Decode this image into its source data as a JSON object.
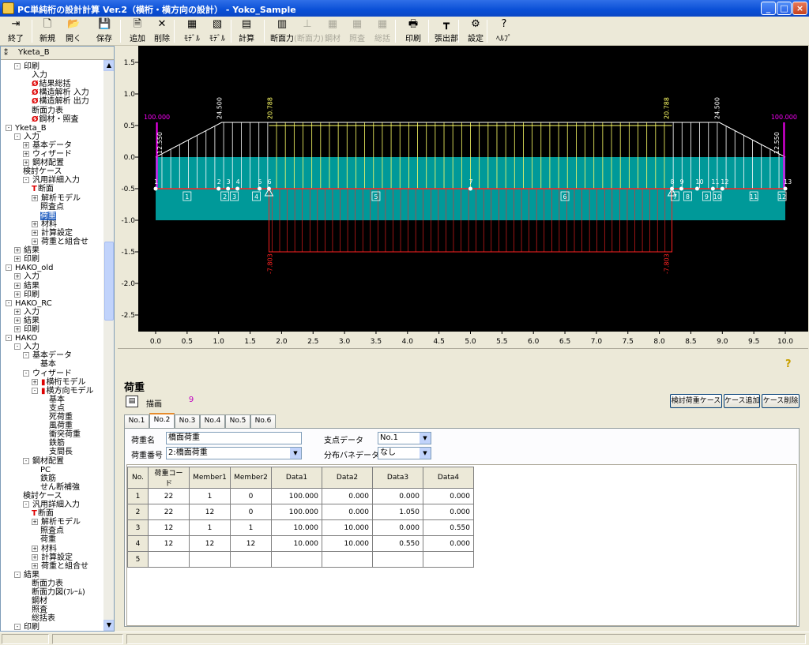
{
  "window": {
    "title": "PC単純桁の設計計算 Ver.2（横桁・横方向の設計） - Yoko_Sample",
    "minimize": "_",
    "maximize": "□",
    "close": "×"
  },
  "toolbar": {
    "items": [
      {
        "label": "終了",
        "icon": "exit-icon",
        "glyph": "⇥"
      },
      {
        "label": "新規",
        "icon": "new-file-icon",
        "glyph": "🗋"
      },
      {
        "label": "開く",
        "icon": "open-folder-icon",
        "glyph": "📂"
      },
      {
        "label": "保存",
        "icon": "save-disk-icon",
        "glyph": "💾"
      },
      {
        "label": "追加",
        "icon": "add-icon",
        "glyph": "🗎"
      },
      {
        "label": "削除",
        "icon": "delete-icon",
        "glyph": "✕"
      },
      {
        "label": "ﾓﾃﾞﾙ",
        "icon": "model-icon",
        "glyph": "▦"
      },
      {
        "label": "ﾓﾃﾞﾙ",
        "icon": "model2-icon",
        "glyph": "▧"
      },
      {
        "label": "計算",
        "icon": "calculate-icon",
        "glyph": "▤"
      },
      {
        "label": "断面力",
        "icon": "section-force-icon",
        "glyph": "▥"
      },
      {
        "label": "(断面力)",
        "icon": "section-force2-icon",
        "glyph": "⊥"
      },
      {
        "label": "鋼材",
        "icon": "steel-icon",
        "glyph": "▦"
      },
      {
        "label": "照査",
        "icon": "check-icon",
        "glyph": "▦"
      },
      {
        "label": "総括",
        "icon": "summary-icon",
        "glyph": "▦"
      },
      {
        "label": "印刷",
        "icon": "print-icon",
        "glyph": "🖶"
      },
      {
        "label": "張出部",
        "icon": "overhang-icon",
        "glyph": "┳"
      },
      {
        "label": "設定",
        "icon": "settings-icon",
        "glyph": "⚙"
      },
      {
        "label": "ﾍﾙﾌﾟ",
        "icon": "help-icon",
        "glyph": "?"
      }
    ]
  },
  "tree": {
    "header": "Yketa_B",
    "nodes": [
      {
        "text": "印刷",
        "indent": 1,
        "toggle": "-"
      },
      {
        "text": "入力",
        "indent": 3
      },
      {
        "text": "結果総括",
        "indent": 3,
        "mark": "Ø"
      },
      {
        "text": "構造解析 入力",
        "indent": 3,
        "mark": "Ø"
      },
      {
        "text": "構造解析 出力",
        "indent": 3,
        "mark": "Ø"
      },
      {
        "text": "断面力表",
        "indent": 3
      },
      {
        "text": "鋼材・照査",
        "indent": 3,
        "mark": "Ø"
      },
      {
        "text": "Yketa_B",
        "indent": 0,
        "toggle": "-"
      },
      {
        "text": "入力",
        "indent": 1,
        "toggle": "-"
      },
      {
        "text": "基本データ",
        "indent": 2,
        "toggle": "+"
      },
      {
        "text": "ウィザード",
        "indent": 2,
        "toggle": "+"
      },
      {
        "text": "鋼材配置",
        "indent": 2,
        "toggle": "+"
      },
      {
        "text": "検討ケース",
        "indent": 2
      },
      {
        "text": "汎用詳細入力",
        "indent": 2,
        "toggle": "-"
      },
      {
        "text": "断面",
        "indent": 3,
        "mark": "T"
      },
      {
        "text": "解析モデル",
        "indent": 3,
        "toggle": "+"
      },
      {
        "text": "照査点",
        "indent": 4
      },
      {
        "text": "荷重",
        "indent": 4,
        "selected": true
      },
      {
        "text": "材料",
        "indent": 3,
        "toggle": "+"
      },
      {
        "text": "計算設定",
        "indent": 3,
        "toggle": "+"
      },
      {
        "text": "荷重と組合せ",
        "indent": 3,
        "toggle": "+"
      },
      {
        "text": "結果",
        "indent": 1,
        "toggle": "+"
      },
      {
        "text": "印刷",
        "indent": 1,
        "toggle": "+"
      },
      {
        "text": "HAKO_old",
        "indent": 0,
        "toggle": "-"
      },
      {
        "text": "入力",
        "indent": 1,
        "toggle": "+"
      },
      {
        "text": "結果",
        "indent": 1,
        "toggle": "+"
      },
      {
        "text": "印刷",
        "indent": 1,
        "toggle": "+"
      },
      {
        "text": "HAKO_RC",
        "indent": 0,
        "toggle": "-"
      },
      {
        "text": "入力",
        "indent": 1,
        "toggle": "+"
      },
      {
        "text": "結果",
        "indent": 1,
        "toggle": "+"
      },
      {
        "text": "印刷",
        "indent": 1,
        "toggle": "+"
      },
      {
        "text": "HAKO",
        "indent": 0,
        "toggle": "-"
      },
      {
        "text": "入力",
        "indent": 1,
        "toggle": "-"
      },
      {
        "text": "基本データ",
        "indent": 2,
        "toggle": "-"
      },
      {
        "text": "基本",
        "indent": 4
      },
      {
        "text": "ウィザード",
        "indent": 2,
        "toggle": "-"
      },
      {
        "text": "横桁モデル",
        "indent": 3,
        "toggle": "+",
        "mark": "▮"
      },
      {
        "text": "横方向モデル",
        "indent": 3,
        "toggle": "-",
        "mark": "▮"
      },
      {
        "text": "基本",
        "indent": 5
      },
      {
        "text": "支点",
        "indent": 5
      },
      {
        "text": "死荷重",
        "indent": 5
      },
      {
        "text": "風荷重",
        "indent": 5
      },
      {
        "text": "衝突荷重",
        "indent": 5
      },
      {
        "text": "鉄筋",
        "indent": 5
      },
      {
        "text": "支間長",
        "indent": 5
      },
      {
        "text": "鋼材配置",
        "indent": 2,
        "toggle": "-"
      },
      {
        "text": "PC",
        "indent": 4
      },
      {
        "text": "鉄筋",
        "indent": 4
      },
      {
        "text": "せん断補強",
        "indent": 4
      },
      {
        "text": "検討ケース",
        "indent": 2
      },
      {
        "text": "汎用詳細入力",
        "indent": 2,
        "toggle": "-"
      },
      {
        "text": "断面",
        "indent": 3,
        "mark": "T"
      },
      {
        "text": "解析モデル",
        "indent": 3,
        "toggle": "+"
      },
      {
        "text": "照査点",
        "indent": 4
      },
      {
        "text": "荷重",
        "indent": 4
      },
      {
        "text": "材料",
        "indent": 3,
        "toggle": "+"
      },
      {
        "text": "計算設定",
        "indent": 3,
        "toggle": "+"
      },
      {
        "text": "荷重と組合せ",
        "indent": 3,
        "toggle": "+"
      },
      {
        "text": "結果",
        "indent": 1,
        "toggle": "-"
      },
      {
        "text": "断面力表",
        "indent": 3
      },
      {
        "text": "断面力図(ﾌﾚｰﾑ)",
        "indent": 3
      },
      {
        "text": "鋼材",
        "indent": 3
      },
      {
        "text": "照査",
        "indent": 3
      },
      {
        "text": "総括表",
        "indent": 3
      },
      {
        "text": "印刷",
        "indent": 1,
        "toggle": "-"
      }
    ]
  },
  "graph": {
    "y_ticks": [
      "1.5",
      "1.0",
      "0.5",
      "0.0",
      "-0.5",
      "-1.0",
      "-1.5",
      "-2.0",
      "-2.5"
    ],
    "x_ticks": [
      "0.0",
      "0.5",
      "1.0",
      "1.5",
      "2.0",
      "2.5",
      "3.0",
      "3.5",
      "4.0",
      "4.5",
      "5.0",
      "5.5",
      "6.0",
      "6.5",
      "7.0",
      "7.5",
      "8.0",
      "8.5",
      "9.0",
      "9.5",
      "10.0"
    ],
    "labels": {
      "mag_left": "100.000",
      "mag_right": "100.000",
      "mag_side_left": "12.550",
      "mag_side_right": "12.550",
      "w24_left": "24.500",
      "w24_right": "24.500",
      "y20_left": "20.788",
      "y20_right": "20.788",
      "red_left": "-7.803",
      "red_right": "-7.803"
    },
    "nodes": [
      "1",
      "2",
      "3",
      "4",
      "5",
      "6",
      "7",
      "8",
      "9",
      "10",
      "11",
      "12",
      "13"
    ],
    "members": [
      "1",
      "2",
      "3",
      "4",
      "5",
      "6",
      "7",
      "8",
      "9",
      "10",
      "11",
      "12"
    ],
    "colors": {
      "magenta": "#ff00ff",
      "white": "#ffffff",
      "yellow": "#ffff66",
      "red": "#ff2222",
      "section": "#009999"
    }
  },
  "panel": {
    "title": "荷重",
    "draw_label": "描画",
    "draw_value": "9",
    "help_icon": "help-icon",
    "buttons": {
      "check_case": "検討荷重ケース",
      "add_case": "ケース追加",
      "del_case": "ケース削除"
    },
    "tabs": [
      "No.1",
      "No.2",
      "No.3",
      "No.4",
      "No.5",
      "No.6"
    ],
    "active_tab": 1,
    "load_name_label": "荷重名",
    "load_name_value": "橋面荷重",
    "load_no_label": "荷重番号",
    "load_no_value": "2:橋面荷重",
    "support_label": "支点データ",
    "support_value": "No.1",
    "spring_label": "分布バネデータ",
    "spring_value": "なし",
    "table": {
      "headers": [
        "No.",
        "荷重コード",
        "Member1",
        "Member2",
        "Data1",
        "Data2",
        "Data3",
        "Data4"
      ],
      "rows": [
        [
          "1",
          "22",
          "1",
          "0",
          "100.000",
          "0.000",
          "0.000",
          "0.000"
        ],
        [
          "2",
          "22",
          "12",
          "0",
          "100.000",
          "0.000",
          "1.050",
          "0.000"
        ],
        [
          "3",
          "12",
          "1",
          "1",
          "10.000",
          "10.000",
          "0.000",
          "0.550"
        ],
        [
          "4",
          "12",
          "12",
          "12",
          "10.000",
          "10.000",
          "0.550",
          "0.000"
        ],
        [
          "5",
          "",
          "",
          "",
          "",
          "",
          "",
          ""
        ]
      ]
    }
  }
}
